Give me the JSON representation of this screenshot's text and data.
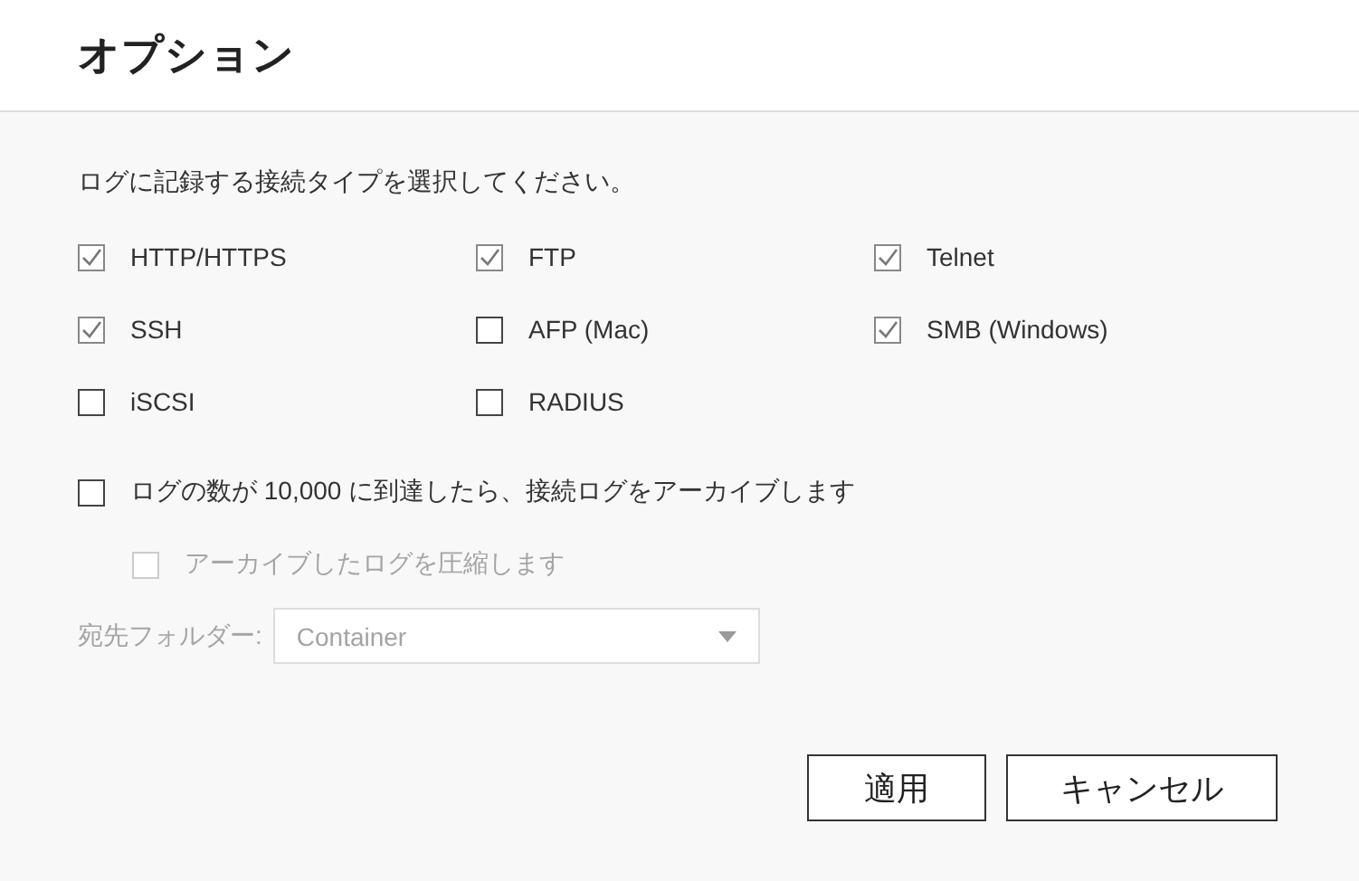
{
  "dialog": {
    "title": "オプション"
  },
  "instruction": "ログに記録する接続タイプを選択してください。",
  "connection_types": [
    {
      "label": "HTTP/HTTPS",
      "checked": true
    },
    {
      "label": "FTP",
      "checked": true
    },
    {
      "label": "Telnet",
      "checked": true
    },
    {
      "label": "SSH",
      "checked": true
    },
    {
      "label": "AFP (Mac)",
      "checked": false
    },
    {
      "label": "SMB (Windows)",
      "checked": true
    },
    {
      "label": "iSCSI",
      "checked": false
    },
    {
      "label": "RADIUS",
      "checked": false
    }
  ],
  "archive": {
    "label": "ログの数が 10,000 に到達したら、接続ログをアーカイブします",
    "checked": false
  },
  "compress": {
    "label": "アーカイブしたログを圧縮します",
    "checked": false,
    "disabled": true
  },
  "destination": {
    "label": "宛先フォルダー:",
    "value": "Container",
    "disabled": true
  },
  "buttons": [
    {
      "label": "適用"
    },
    {
      "label": "キャンセル"
    }
  ]
}
